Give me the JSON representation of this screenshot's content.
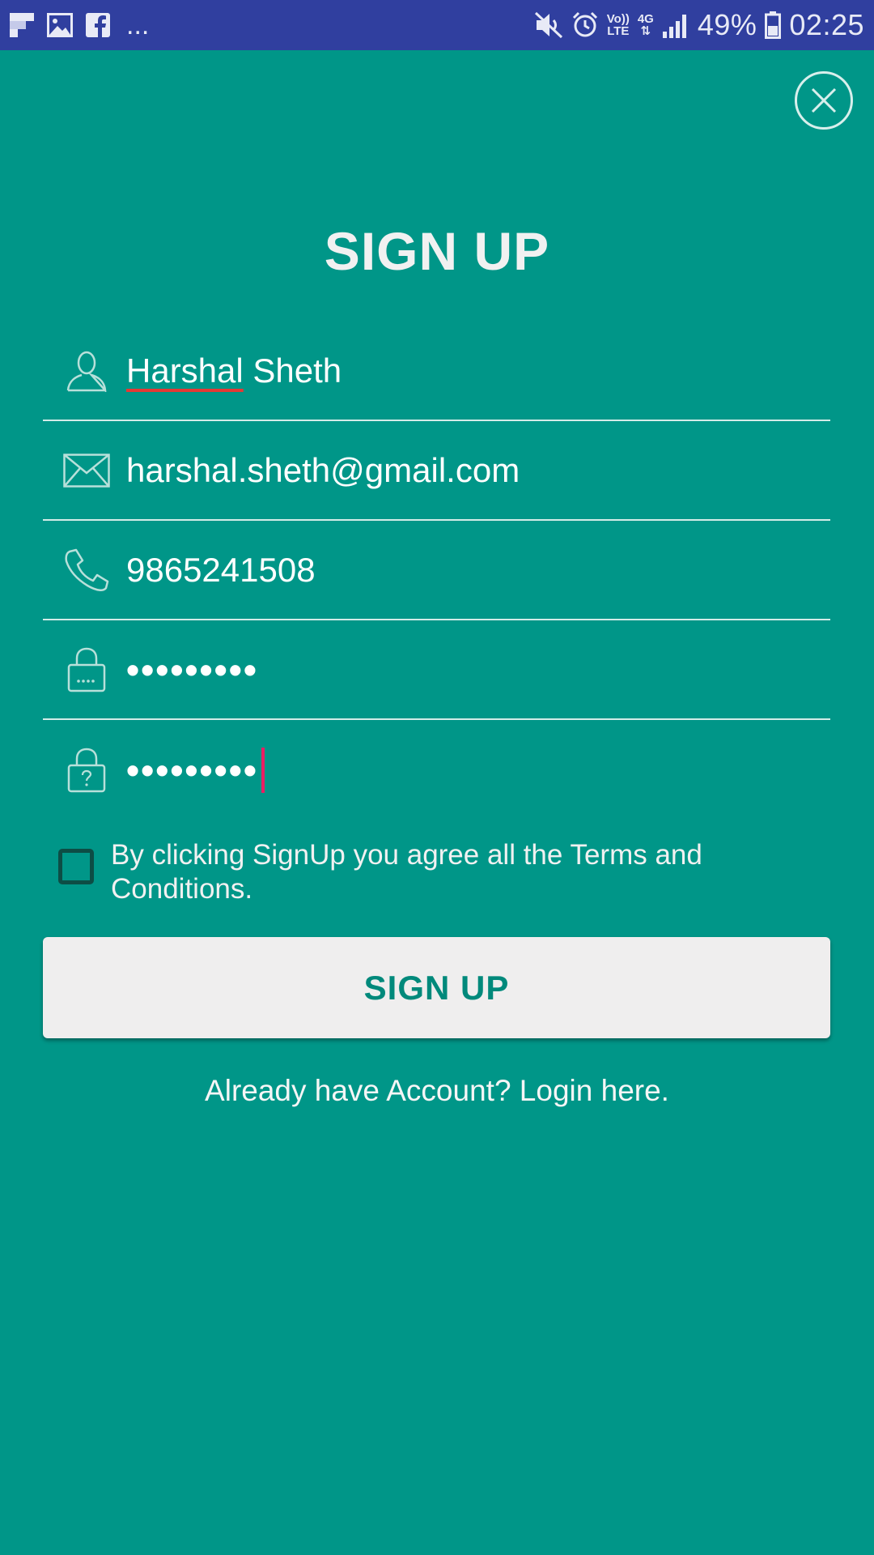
{
  "status_bar": {
    "left_icons": [
      "flipboard-icon",
      "image-icon",
      "facebook-icon"
    ],
    "overflow": "...",
    "network_line1": "Vo))",
    "network_line2": "LTE",
    "network_type": "4G",
    "battery_percent": "49%",
    "time": "02:25"
  },
  "header": {
    "title": "SIGN UP",
    "close_icon": "close-icon"
  },
  "form": {
    "name_part1": "Harshal",
    "name_part2": " Sheth",
    "email": "harshal.sheth@gmail.com",
    "phone": "9865241508",
    "password": "•••••••••",
    "confirm_password": "•••••••••",
    "icons": [
      "user-icon",
      "mail-icon",
      "phone-icon",
      "lock-icon",
      "lock-question-icon"
    ]
  },
  "terms": {
    "checked": false,
    "text": "By clicking SignUp you agree all the Terms and Conditions."
  },
  "signup_button": {
    "label": "SIGN UP"
  },
  "login_link": {
    "text": "Already have Account? Login here."
  },
  "colors": {
    "background": "#009688",
    "status_bar": "#303F9F",
    "button_bg": "#efeeee",
    "button_text": "#00897b",
    "cursor": "#e91e63"
  }
}
